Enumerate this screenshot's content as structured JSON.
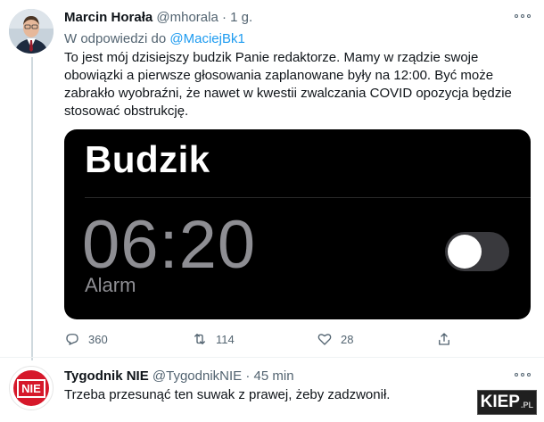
{
  "tweet": {
    "author_name": "Marcin Horała",
    "author_handle": "@mhorala",
    "separator": "·",
    "time": "1 g.",
    "reply_prefix": "W odpowiedzi do",
    "reply_to": "@MaciejBk1",
    "text": "To jest mój dzisiejszy budzik Panie redaktorze. Mamy w rządzie swoje obowiązki a pierwsze głosowania zaplanowane były na 12:00. Być może zabrakło wyobraźni, że nawet w kwestii zwalczania COVID opozycja będzie stosować obstrukcję.",
    "media": {
      "title": "Budzik",
      "alarm_time": "06:20",
      "alarm_label": "Alarm",
      "toggle_on": false
    },
    "actions": {
      "replies": "360",
      "retweets": "114",
      "likes": "28"
    }
  },
  "reply": {
    "author_name": "Tygodnik NIE",
    "author_handle": "@TygodnikNIE",
    "separator": "·",
    "time": "45 min",
    "avatar_text": "NIE",
    "text": "Trzeba przesunąć ten suwak z prawej, żeby zadzwonił."
  },
  "watermark": {
    "main": "KIEP",
    "suffix": ".PL"
  },
  "colors": {
    "link": "#1d9bf0",
    "secondary_text": "#536471",
    "alarm_grey": "#8e8e93",
    "avatar_red": "#d6182a"
  }
}
